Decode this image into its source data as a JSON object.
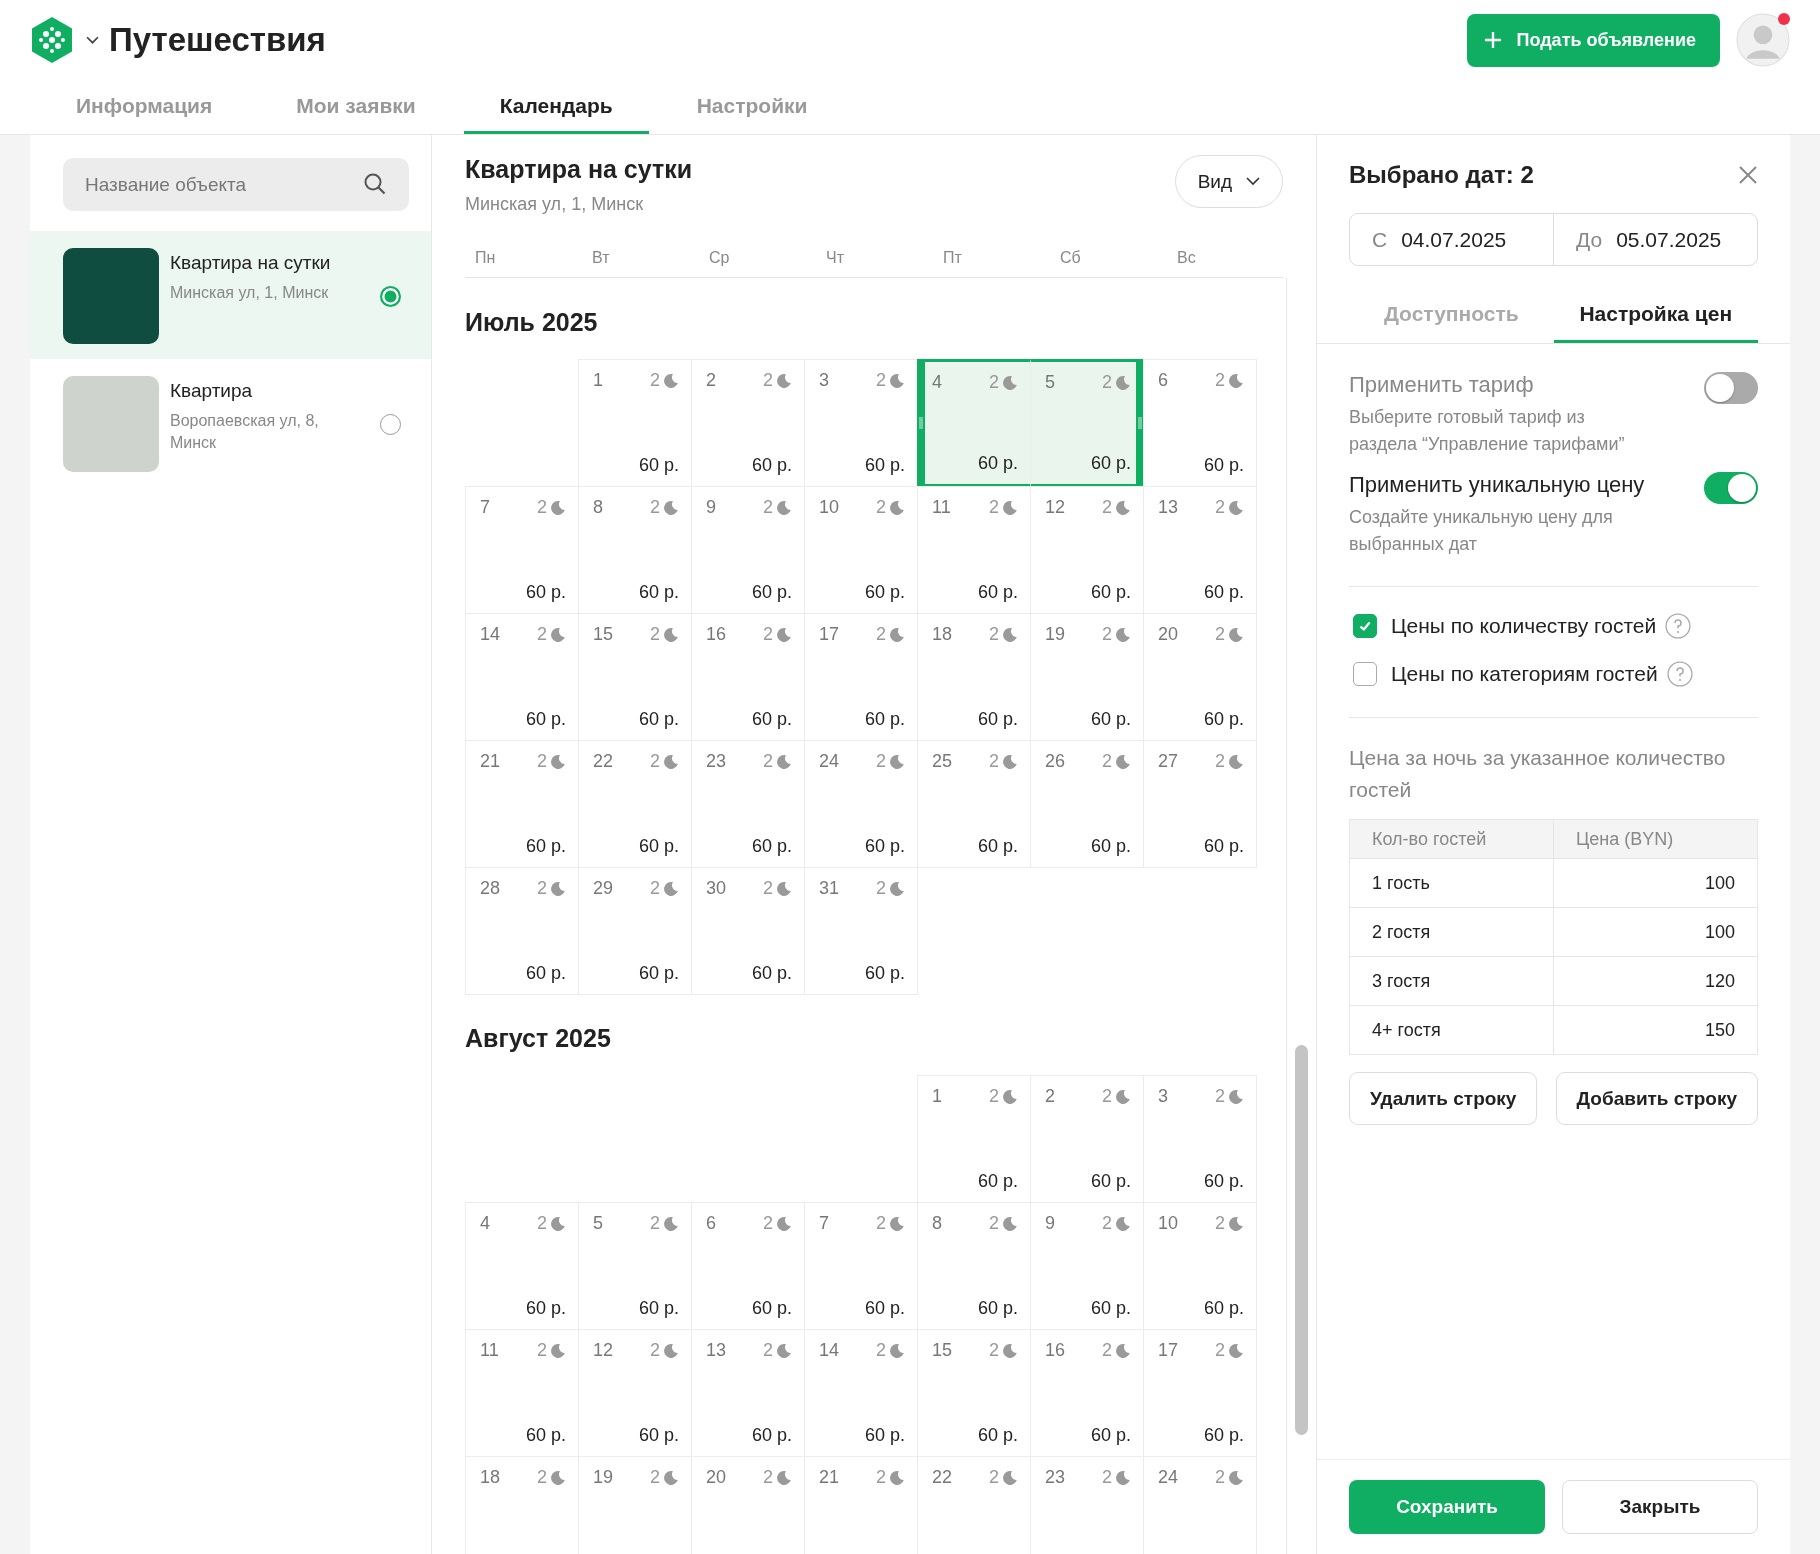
{
  "header": {
    "app_title": "Путешествия",
    "post_button": "Подать объявление",
    "avatar": {
      "notification": true
    }
  },
  "nav_tabs": [
    {
      "label": "Информация",
      "selected": false
    },
    {
      "label": "Мои заявки",
      "selected": false
    },
    {
      "label": "Календарь",
      "selected": true
    },
    {
      "label": "Настройки",
      "selected": false
    }
  ],
  "sidebar": {
    "search": {
      "placeholder": "Название объекта"
    },
    "listings": [
      {
        "title": "Квартира на сутки",
        "address": "Минская ул, 1, Минск",
        "selected": true
      },
      {
        "title": "Квартира",
        "address": "Воропаевская ул, 8, Минск",
        "selected": false
      }
    ]
  },
  "calendar": {
    "title": "Квартира на сутки",
    "address": "Минская ул, 1, Минск",
    "view_button": "Вид",
    "weekdays": [
      "Пн",
      "Вт",
      "Ср",
      "Чт",
      "Пт",
      "Сб",
      "Вс"
    ],
    "months": [
      {
        "title": "Июль 2025",
        "weeks": [
          [
            {
              "kind": "blank"
            },
            {
              "kind": "day",
              "day": "1",
              "nights": "2",
              "price": "60 р.",
              "selected": false
            },
            {
              "kind": "day",
              "day": "2",
              "nights": "2",
              "price": "60 р.",
              "selected": false
            },
            {
              "kind": "day",
              "day": "3",
              "nights": "2",
              "price": "60 р.",
              "selected": false
            },
            {
              "kind": "day",
              "day": "4",
              "nights": "2",
              "price": "60 р.",
              "selected": true
            },
            {
              "kind": "day",
              "day": "5",
              "nights": "2",
              "price": "60 р.",
              "selected": true
            },
            {
              "kind": "day",
              "day": "6",
              "nights": "2",
              "price": "60 р.",
              "selected": false
            }
          ],
          [
            {
              "kind": "day",
              "day": "7",
              "nights": "2",
              "price": "60 р.",
              "selected": false
            },
            {
              "kind": "day",
              "day": "8",
              "nights": "2",
              "price": "60 р.",
              "selected": false
            },
            {
              "kind": "day",
              "day": "9",
              "nights": "2",
              "price": "60 р.",
              "selected": false
            },
            {
              "kind": "day",
              "day": "10",
              "nights": "2",
              "price": "60 р.",
              "selected": false
            },
            {
              "kind": "day",
              "day": "11",
              "nights": "2",
              "price": "60 р.",
              "selected": false
            },
            {
              "kind": "day",
              "day": "12",
              "nights": "2",
              "price": "60 р.",
              "selected": false
            },
            {
              "kind": "day",
              "day": "13",
              "nights": "2",
              "price": "60 р.",
              "selected": false
            }
          ],
          [
            {
              "kind": "day",
              "day": "14",
              "nights": "2",
              "price": "60 р.",
              "selected": false
            },
            {
              "kind": "day",
              "day": "15",
              "nights": "2",
              "price": "60 р.",
              "selected": false
            },
            {
              "kind": "day",
              "day": "16",
              "nights": "2",
              "price": "60 р.",
              "selected": false
            },
            {
              "kind": "day",
              "day": "17",
              "nights": "2",
              "price": "60 р.",
              "selected": false
            },
            {
              "kind": "day",
              "day": "18",
              "nights": "2",
              "price": "60 р.",
              "selected": false
            },
            {
              "kind": "day",
              "day": "19",
              "nights": "2",
              "price": "60 р.",
              "selected": false
            },
            {
              "kind": "day",
              "day": "20",
              "nights": "2",
              "price": "60 р.",
              "selected": false
            }
          ],
          [
            {
              "kind": "day",
              "day": "21",
              "nights": "2",
              "price": "60 р.",
              "selected": false
            },
            {
              "kind": "day",
              "day": "22",
              "nights": "2",
              "price": "60 р.",
              "selected": false
            },
            {
              "kind": "day",
              "day": "23",
              "nights": "2",
              "price": "60 р.",
              "selected": false
            },
            {
              "kind": "day",
              "day": "24",
              "nights": "2",
              "price": "60 р.",
              "selected": false
            },
            {
              "kind": "day",
              "day": "25",
              "nights": "2",
              "price": "60 р.",
              "selected": false
            },
            {
              "kind": "day",
              "day": "26",
              "nights": "2",
              "price": "60 р.",
              "selected": false
            },
            {
              "kind": "day",
              "day": "27",
              "nights": "2",
              "price": "60 р.",
              "selected": false
            }
          ],
          [
            {
              "kind": "day",
              "day": "28",
              "nights": "2",
              "price": "60 р.",
              "selected": false
            },
            {
              "kind": "day",
              "day": "29",
              "nights": "2",
              "price": "60 р.",
              "selected": false
            },
            {
              "kind": "day",
              "day": "30",
              "nights": "2",
              "price": "60 р.",
              "selected": false
            },
            {
              "kind": "day",
              "day": "31",
              "nights": "2",
              "price": "60 р.",
              "selected": false
            }
          ]
        ]
      },
      {
        "title": "Август 2025",
        "weeks": [
          [
            {
              "kind": "blank"
            },
            {
              "kind": "blank"
            },
            {
              "kind": "blank"
            },
            {
              "kind": "blank"
            },
            {
              "kind": "day",
              "day": "1",
              "nights": "2",
              "price": "60 р.",
              "selected": false
            },
            {
              "kind": "day",
              "day": "2",
              "nights": "2",
              "price": "60 р.",
              "selected": false
            },
            {
              "kind": "day",
              "day": "3",
              "nights": "2",
              "price": "60 р.",
              "selected": false
            }
          ],
          [
            {
              "kind": "day",
              "day": "4",
              "nights": "2",
              "price": "60 р.",
              "selected": false
            },
            {
              "kind": "day",
              "day": "5",
              "nights": "2",
              "price": "60 р.",
              "selected": false
            },
            {
              "kind": "day",
              "day": "6",
              "nights": "2",
              "price": "60 р.",
              "selected": false
            },
            {
              "kind": "day",
              "day": "7",
              "nights": "2",
              "price": "60 р.",
              "selected": false
            },
            {
              "kind": "day",
              "day": "8",
              "nights": "2",
              "price": "60 р.",
              "selected": false
            },
            {
              "kind": "day",
              "day": "9",
              "nights": "2",
              "price": "60 р.",
              "selected": false
            },
            {
              "kind": "day",
              "day": "10",
              "nights": "2",
              "price": "60 р.",
              "selected": false
            }
          ],
          [
            {
              "kind": "day",
              "day": "11",
              "nights": "2",
              "price": "60 р.",
              "selected": false
            },
            {
              "kind": "day",
              "day": "12",
              "nights": "2",
              "price": "60 р.",
              "selected": false
            },
            {
              "kind": "day",
              "day": "13",
              "nights": "2",
              "price": "60 р.",
              "selected": false
            },
            {
              "kind": "day",
              "day": "14",
              "nights": "2",
              "price": "60 р.",
              "selected": false
            },
            {
              "kind": "day",
              "day": "15",
              "nights": "2",
              "price": "60 р.",
              "selected": false
            },
            {
              "kind": "day",
              "day": "16",
              "nights": "2",
              "price": "60 р.",
              "selected": false
            },
            {
              "kind": "day",
              "day": "17",
              "nights": "2",
              "price": "60 р.",
              "selected": false
            }
          ],
          [
            {
              "kind": "day",
              "day": "18",
              "nights": "2",
              "selected": false
            },
            {
              "kind": "day",
              "day": "19",
              "nights": "2",
              "selected": false
            },
            {
              "kind": "day",
              "day": "20",
              "nights": "2",
              "selected": false
            },
            {
              "kind": "day",
              "day": "21",
              "nights": "2",
              "selected": false
            },
            {
              "kind": "day",
              "day": "22",
              "nights": "2",
              "selected": false
            },
            {
              "kind": "day",
              "day": "23",
              "nights": "2",
              "selected": false
            },
            {
              "kind": "day",
              "day": "24",
              "nights": "2",
              "selected": false
            }
          ]
        ]
      }
    ]
  },
  "panel": {
    "title": "Выбрано дат: 2",
    "date_range": {
      "from": {
        "label": "С",
        "value": "04.07.2025"
      },
      "to": {
        "label": "До",
        "value": "05.07.2025"
      }
    },
    "tabs": [
      {
        "label": "Доступность",
        "selected": false
      },
      {
        "label": "Настройка цен",
        "selected": true
      }
    ],
    "toggles": [
      {
        "label": "Применить тариф",
        "hint": "Выберите готовый тариф из раздела “Управление тарифами”",
        "on": false
      },
      {
        "label": "Применить уникальную цену",
        "hint": "Создайте уникальную цену для выбранных дат",
        "on": true
      }
    ],
    "checkboxes": [
      {
        "label": "Цены по количеству гостей",
        "checked": true
      },
      {
        "label": "Цены по категориям гостей",
        "checked": false
      }
    ],
    "table_caption": "Цена за ночь за указанное количество гостей",
    "table": {
      "columns": [
        "Кол-во гостей",
        "Цена (BYN)"
      ],
      "rows": [
        [
          "1 гость",
          "100"
        ],
        [
          "2 гостя",
          "100"
        ],
        [
          "3 гостя",
          "120"
        ],
        [
          "4+ гостя",
          "150"
        ]
      ]
    },
    "row_buttons": [
      "Удалить строку",
      "Добавить строку"
    ],
    "footer_buttons": [
      {
        "label": "Сохранить",
        "kind": "primary"
      },
      {
        "label": "Закрыть",
        "kind": "secondary"
      }
    ]
  }
}
